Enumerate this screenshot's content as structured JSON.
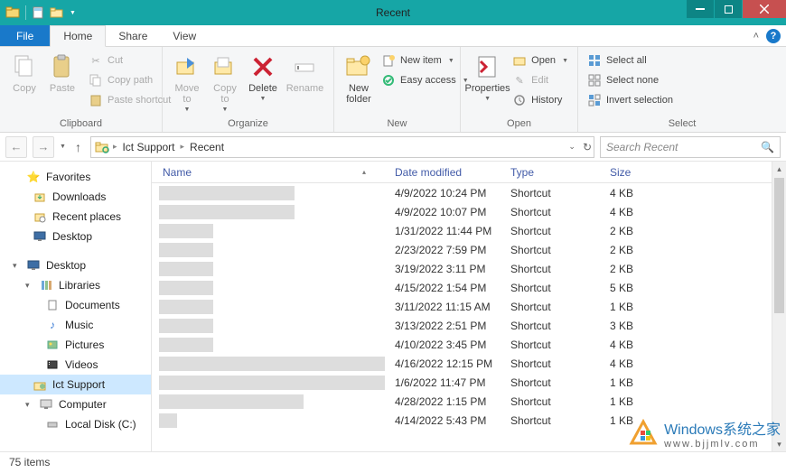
{
  "window": {
    "title": "Recent"
  },
  "tabs": {
    "file": "File",
    "home": "Home",
    "share": "Share",
    "view": "View"
  },
  "ribbon": {
    "clipboard": {
      "label": "Clipboard",
      "copy": "Copy",
      "paste": "Paste",
      "cut": "Cut",
      "copy_path": "Copy path",
      "paste_shortcut": "Paste shortcut"
    },
    "organize": {
      "label": "Organize",
      "move_to": "Move\nto",
      "copy_to": "Copy\nto",
      "delete": "Delete",
      "rename": "Rename"
    },
    "new": {
      "label": "New",
      "new_folder": "New\nfolder",
      "new_item": "New item",
      "easy_access": "Easy access"
    },
    "open": {
      "label": "Open",
      "properties": "Properties",
      "open": "Open",
      "edit": "Edit",
      "history": "History"
    },
    "select": {
      "label": "Select",
      "select_all": "Select all",
      "select_none": "Select none",
      "invert": "Invert selection"
    }
  },
  "breadcrumb": {
    "part1": "Ict Support",
    "part2": "Recent"
  },
  "search": {
    "placeholder": "Search Recent"
  },
  "sidebar": {
    "favorites": "Favorites",
    "downloads": "Downloads",
    "recent_places": "Recent places",
    "desktop_fav": "Desktop",
    "desktop": "Desktop",
    "libraries": "Libraries",
    "documents": "Documents",
    "music": "Music",
    "pictures": "Pictures",
    "videos": "Videos",
    "ict_support": "Ict Support",
    "computer": "Computer",
    "local_disk": "Local Disk (C:)"
  },
  "columns": {
    "name": "Name",
    "date": "Date modified",
    "type": "Type",
    "size": "Size"
  },
  "rows": [
    {
      "date": "4/9/2022 10:24 PM",
      "type": "Shortcut",
      "size": "4 KB",
      "nw": 150
    },
    {
      "date": "4/9/2022 10:07 PM",
      "type": "Shortcut",
      "size": "4 KB",
      "nw": 150
    },
    {
      "date": "1/31/2022 11:44 PM",
      "type": "Shortcut",
      "size": "2 KB",
      "nw": 60
    },
    {
      "date": "2/23/2022 7:59 PM",
      "type": "Shortcut",
      "size": "2 KB",
      "nw": 60
    },
    {
      "date": "3/19/2022 3:11 PM",
      "type": "Shortcut",
      "size": "2 KB",
      "nw": 60
    },
    {
      "date": "4/15/2022 1:54 PM",
      "type": "Shortcut",
      "size": "5 KB",
      "nw": 60
    },
    {
      "date": "3/11/2022 11:15 AM",
      "type": "Shortcut",
      "size": "1 KB",
      "nw": 60
    },
    {
      "date": "3/13/2022 2:51 PM",
      "type": "Shortcut",
      "size": "3 KB",
      "nw": 60
    },
    {
      "date": "4/10/2022 3:45 PM",
      "type": "Shortcut",
      "size": "4 KB",
      "nw": 60
    },
    {
      "date": "4/16/2022 12:15 PM",
      "type": "Shortcut",
      "size": "4 KB",
      "nw": 250
    },
    {
      "date": "1/6/2022 11:47 PM",
      "type": "Shortcut",
      "size": "1 KB",
      "nw": 250
    },
    {
      "date": "4/28/2022 1:15 PM",
      "type": "Shortcut",
      "size": "1 KB",
      "nw": 160
    },
    {
      "date": "4/14/2022 5:43 PM",
      "type": "Shortcut",
      "size": "1 KB",
      "nw": 20
    }
  ],
  "status": {
    "item_count": "75 items"
  },
  "watermark": {
    "line1": "Windows",
    "line1b": "系统之家",
    "line2": "www.bjjmlv.com"
  }
}
